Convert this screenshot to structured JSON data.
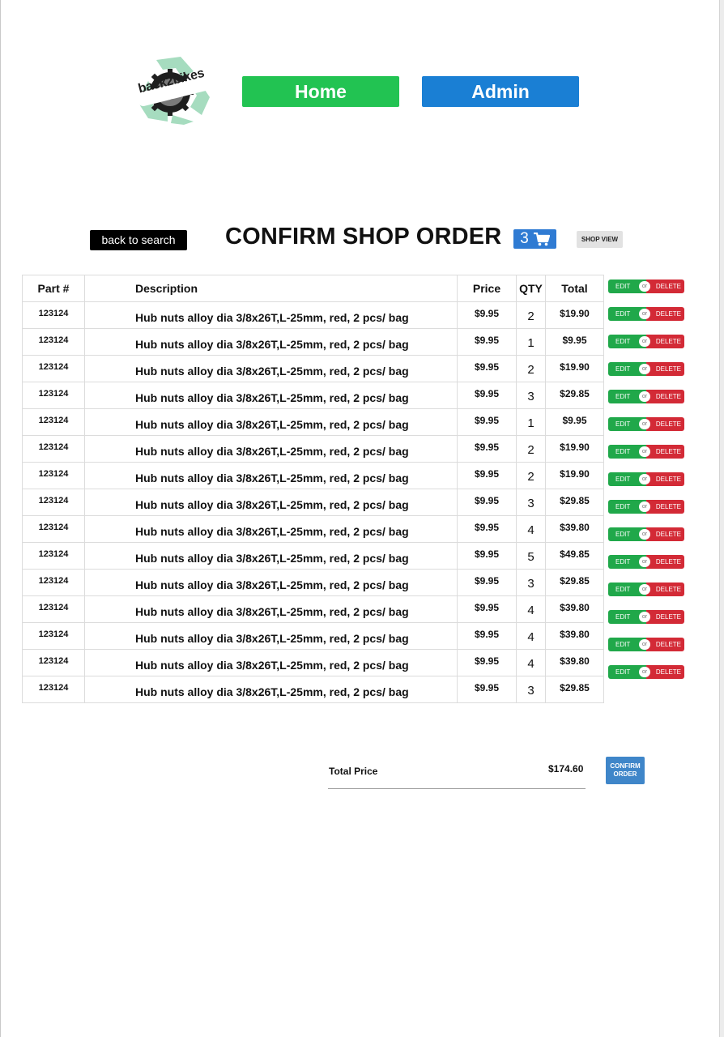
{
  "brand": {
    "logo_text": "back2bikes"
  },
  "nav": {
    "home_label": "Home",
    "admin_label": "Admin"
  },
  "colors": {
    "home_green": "#22c352",
    "admin_blue": "#1a7fd4",
    "badge_blue": "#2f7bd3",
    "edit_green": "#20a84a",
    "delete_red": "#d32a36",
    "confirm_blue": "#3f86c9"
  },
  "toolbar": {
    "back_label": "back to search",
    "title": "CONFIRM SHOP ORDER",
    "cart_count": "3",
    "cart_icon": "shopping-cart-icon",
    "shop_view_label": "SHOP VIEW"
  },
  "table": {
    "headers": {
      "part": "Part #",
      "description": "Description",
      "price": "Price",
      "qty": "QTY",
      "total": "Total"
    },
    "rows": [
      {
        "part": "123124",
        "description": "Hub nuts alloy dia 3/8x26T,L-25mm, red, 2 pcs/ bag",
        "price": "$9.95",
        "qty": "2",
        "total": "$19.90"
      },
      {
        "part": "123124",
        "description": "Hub nuts alloy dia 3/8x26T,L-25mm, red, 2 pcs/ bag",
        "price": "$9.95",
        "qty": "1",
        "total": "$9.95"
      },
      {
        "part": "123124",
        "description": "Hub nuts alloy dia 3/8x26T,L-25mm, red, 2 pcs/ bag",
        "price": "$9.95",
        "qty": "2",
        "total": "$19.90"
      },
      {
        "part": "123124",
        "description": "Hub nuts alloy dia 3/8x26T,L-25mm, red, 2 pcs/ bag",
        "price": "$9.95",
        "qty": "3",
        "total": "$29.85"
      },
      {
        "part": "123124",
        "description": "Hub nuts alloy dia 3/8x26T,L-25mm, red, 2 pcs/ bag",
        "price": "$9.95",
        "qty": "1",
        "total": "$9.95"
      },
      {
        "part": "123124",
        "description": "Hub nuts alloy dia 3/8x26T,L-25mm, red, 2 pcs/ bag",
        "price": "$9.95",
        "qty": "2",
        "total": "$19.90"
      },
      {
        "part": "123124",
        "description": "Hub nuts alloy dia 3/8x26T,L-25mm, red, 2 pcs/ bag",
        "price": "$9.95",
        "qty": "2",
        "total": "$19.90"
      },
      {
        "part": "123124",
        "description": "Hub nuts alloy dia 3/8x26T,L-25mm, red, 2 pcs/ bag",
        "price": "$9.95",
        "qty": "3",
        "total": "$29.85"
      },
      {
        "part": "123124",
        "description": "Hub nuts alloy dia 3/8x26T,L-25mm, red, 2 pcs/ bag",
        "price": "$9.95",
        "qty": "4",
        "total": "$39.80"
      },
      {
        "part": "123124",
        "description": "Hub nuts alloy dia 3/8x26T,L-25mm, red, 2 pcs/ bag",
        "price": "$9.95",
        "qty": "5",
        "total": "$49.85"
      },
      {
        "part": "123124",
        "description": "Hub nuts alloy dia 3/8x26T,L-25mm, red, 2 pcs/ bag",
        "price": "$9.95",
        "qty": "3",
        "total": "$29.85"
      },
      {
        "part": "123124",
        "description": "Hub nuts alloy dia 3/8x26T,L-25mm, red, 2 pcs/ bag",
        "price": "$9.95",
        "qty": "4",
        "total": "$39.80"
      },
      {
        "part": "123124",
        "description": "Hub nuts alloy dia 3/8x26T,L-25mm, red, 2 pcs/ bag",
        "price": "$9.95",
        "qty": "4",
        "total": "$39.80"
      },
      {
        "part": "123124",
        "description": "Hub nuts alloy dia 3/8x26T,L-25mm, red, 2 pcs/ bag",
        "price": "$9.95",
        "qty": "4",
        "total": "$39.80"
      },
      {
        "part": "123124",
        "description": "Hub nuts alloy dia 3/8x26T,L-25mm, red, 2 pcs/ bag",
        "price": "$9.95",
        "qty": "3",
        "total": "$29.85"
      }
    ]
  },
  "row_actions": {
    "edit_label": "EDIT",
    "or_label": "or",
    "delete_label": "DELETE"
  },
  "summary": {
    "total_label": "Total Price",
    "total_value": "$174.60",
    "confirm_label": "CONFIRM ORDER"
  }
}
